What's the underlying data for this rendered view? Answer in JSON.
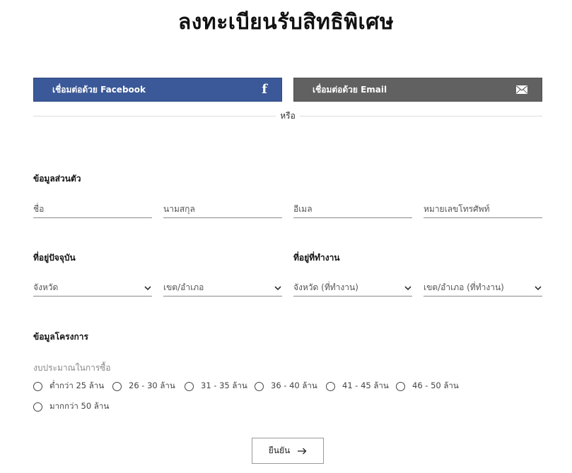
{
  "page_title": "ลงทะเบียนรับสิทธิพิเศษ",
  "social": {
    "facebook_label": "เชื่อมต่อด้วย Facebook",
    "facebook_icon": "facebook-f-icon",
    "facebook_color": "#3b5998",
    "email_label": "เชื่อมต่อด้วย Email",
    "email_icon": "mail-icon",
    "email_color": "#616161",
    "or_text": "หรือ"
  },
  "personal": {
    "title": "ข้อมูลส่วนตัว",
    "first_name_placeholder": "ชื่อ",
    "last_name_placeholder": "นามสกุล",
    "email_placeholder": "อีเมล",
    "phone_placeholder": "หมายเลขโทรศัพท์"
  },
  "current_address": {
    "title": "ที่อยู่ปัจจุบัน",
    "province": "จังหวัด",
    "district": "เขต/อำเภอ"
  },
  "work_address": {
    "title": "ที่อยู่ที่ทำงาน",
    "province": "จังหวัด (ที่ทำงาน)",
    "district": "เขต/อำเภอ (ที่ทำงาน)"
  },
  "project": {
    "title": "ข้อมูลโครงการ",
    "budget_label": "งบประมาณในการซื้อ",
    "budget_options": [
      "ต่ำกว่า 25 ล้าน",
      "26 - 30 ล้าน",
      "31 - 35 ล้าน",
      "36 - 40 ล้าน",
      "41 - 45 ล้าน",
      "46 - 50 ล้าน",
      "มากกว่า 50 ล้าน"
    ]
  },
  "submit": {
    "label": "ยืนยัน",
    "icon": "arrow-right-icon"
  }
}
